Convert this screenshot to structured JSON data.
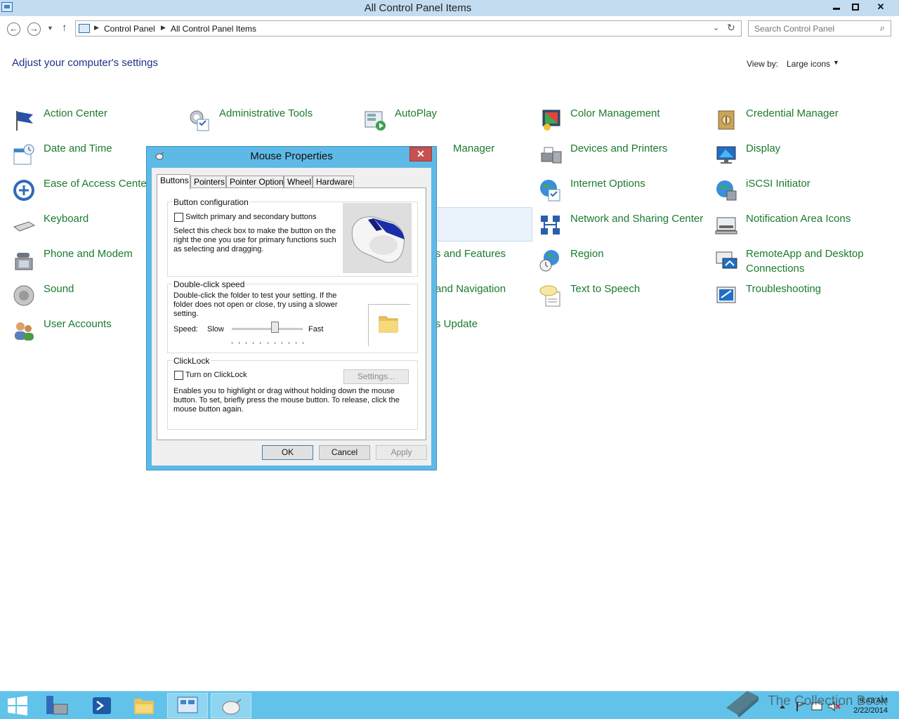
{
  "window": {
    "title": "All Control Panel Items",
    "minimize_icon": "minimize-icon",
    "maximize_icon": "restore-icon",
    "close_glyph": "✕"
  },
  "addressbar": {
    "crumbs": [
      "Control Panel",
      "All Control Panel Items"
    ],
    "search_placeholder": "Search Control Panel"
  },
  "header": {
    "title": "Adjust your computer's settings",
    "view_by_label": "View by:",
    "view_by_value": "Large icons"
  },
  "items": {
    "action_center": "Action Center",
    "administrative_tools": "Administrative Tools",
    "autoplay": "AutoPlay",
    "color_management": "Color Management",
    "credential_manager": "Credential Manager",
    "date_time": "Date and Time",
    "device_manager_fragment": "Manager",
    "devices_printers": "Devices and Printers",
    "display": "Display",
    "ease_of_access": "Ease of Access Center",
    "internet_options": "Internet Options",
    "iscsi": "iSCSI Initiator",
    "keyboard": "Keyboard",
    "network_sharing": "Network and Sharing Center",
    "notification_area": "Notification Area Icons",
    "phone_modem": "Phone and Modem",
    "programs_fragment": "s and Features",
    "region": "Region",
    "remoteapp": "RemoteApp and Desktop Connections",
    "sound": "Sound",
    "navigation_fragment": "and Navigation",
    "text_to_speech": "Text to Speech",
    "troubleshooting": "Troubleshooting",
    "user_accounts": "User Accounts",
    "update_fragment": "s Update"
  },
  "dialog": {
    "title": "Mouse Properties",
    "close_glyph": "✕",
    "tabs": [
      "Buttons",
      "Pointers",
      "Pointer Options",
      "Wheel",
      "Hardware"
    ],
    "button_config": {
      "label": "Button configuration",
      "checkbox_label": "Switch primary and secondary buttons",
      "checked": false,
      "description_lines": [
        "Select this check box to make the button on the",
        "right the one you use for primary functions such",
        "as selecting and dragging."
      ]
    },
    "double_click": {
      "label": "Double-click speed",
      "description_lines": [
        "Double-click the folder to test your setting. If the",
        "folder does not open or close, try using a slower",
        "setting."
      ],
      "speed_label": "Speed:",
      "slow_label": "Slow",
      "fast_label": "Fast",
      "speed_value": 0.6
    },
    "clicklock": {
      "label": "ClickLock",
      "checkbox_label": "Turn on ClickLock",
      "checked": false,
      "settings_button": "Settings...",
      "description_lines": [
        "Enables you to highlight or drag without holding down the mouse",
        "button. To set, briefly press the mouse button. To release, click the",
        "mouse button again."
      ]
    },
    "ok_button": "OK",
    "cancel_button": "Cancel",
    "apply_button": "Apply"
  },
  "taskbar": {
    "time": "9:43 AM",
    "date": "2/22/2014",
    "watermark": "The Collection Book"
  },
  "colors": {
    "link_green": "#1b7a2e",
    "heading_blue": "#1e3287",
    "taskbar": "#62c3ea",
    "dialog_frame": "#5fb9e6",
    "close_red": "#c75050"
  }
}
